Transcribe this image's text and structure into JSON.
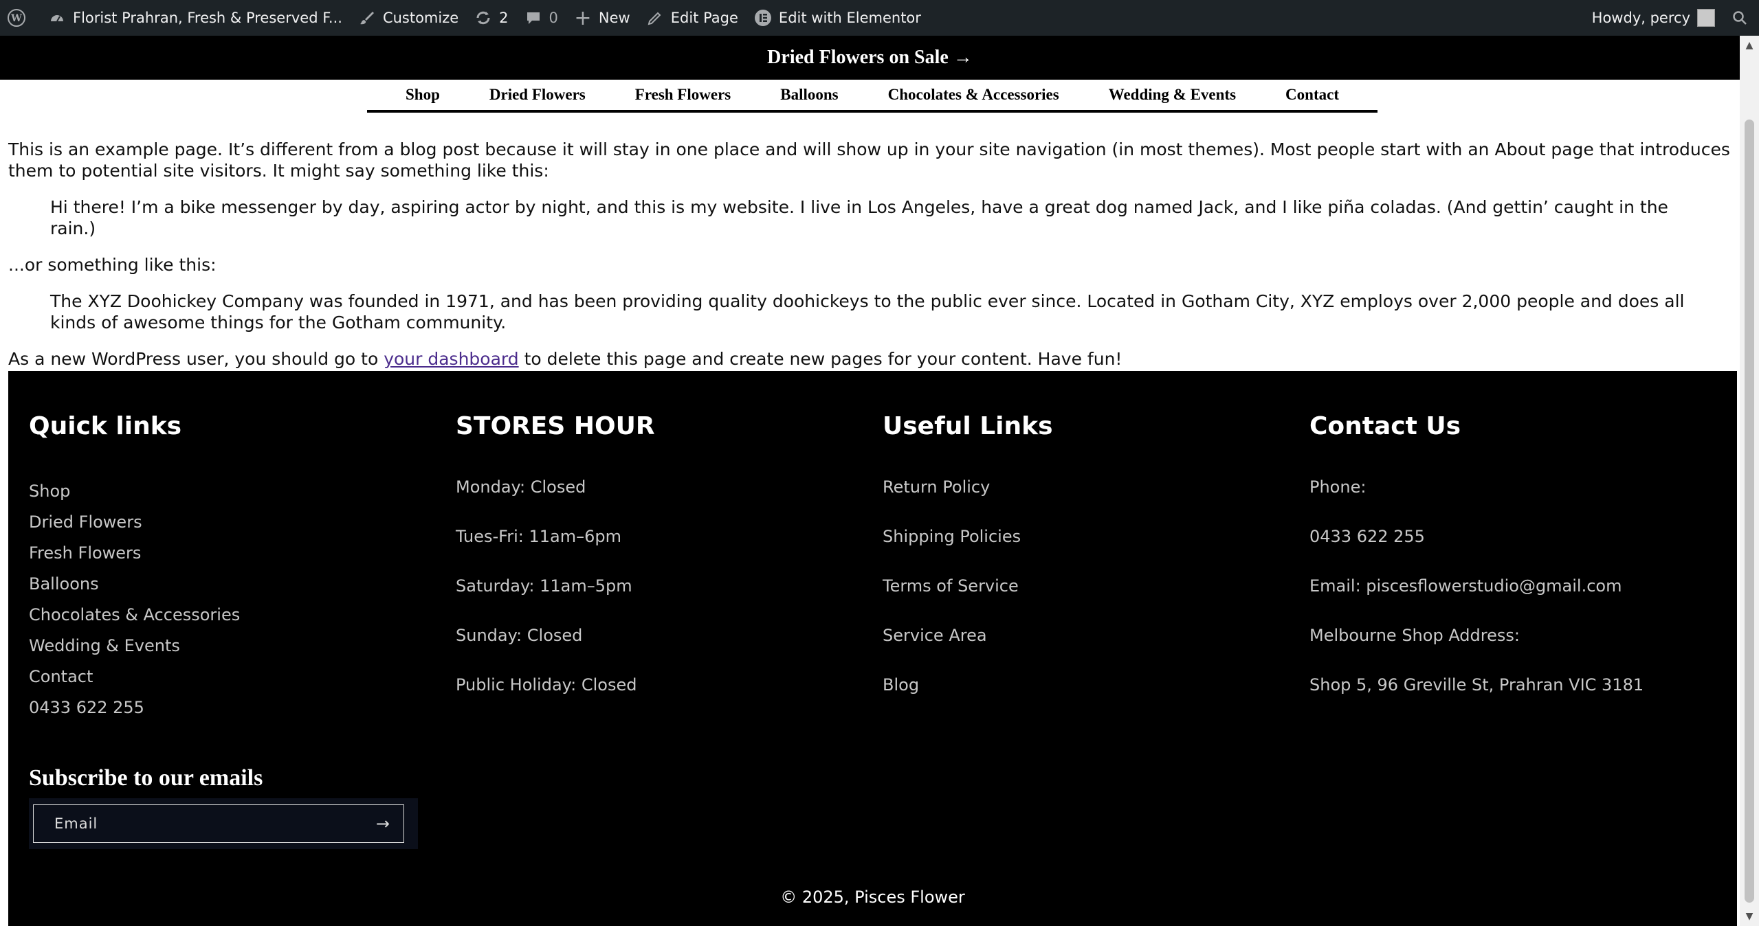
{
  "adminbar": {
    "site_name": "Florist Prahran, Fresh & Preserved F...",
    "customize": "Customize",
    "updates_count": "2",
    "comments_count": "0",
    "new": "New",
    "edit_page": "Edit Page",
    "edit_elementor": "Edit with Elementor",
    "howdy": "Howdy, percy"
  },
  "announcement": "Dried Flowers on Sale →",
  "nav": [
    "Shop",
    "Dried Flowers",
    "Fresh Flowers",
    "Balloons",
    "Chocolates & Accessories",
    "Wedding & Events",
    "Contact"
  ],
  "content": {
    "p1": "This is an example page. It’s different from a blog post because it will stay in one place and will show up in your site navigation (in most themes). Most people start with an About page that introduces them to potential site visitors. It might say something like this:",
    "quote1": "Hi there! I’m a bike messenger by day, aspiring actor by night, and this is my website. I live in Los Angeles, have a great dog named Jack, and I like piña coladas. (And gettin’ caught in the rain.)",
    "p2": "...or something like this:",
    "quote2": "The XYZ Doohickey Company was founded in 1971, and has been providing quality doohickeys to the public ever since. Located in Gotham City, XYZ employs over 2,000 people and does all kinds of awesome things for the Gotham community.",
    "p3_before": "As a new WordPress user, you should go to ",
    "p3_link": "your dashboard",
    "p3_after": " to delete this page and create new pages for your content. Have fun!"
  },
  "footer": {
    "quick_links": {
      "title": "Quick links",
      "items": [
        "Shop",
        "Dried Flowers",
        "Fresh Flowers",
        "Balloons",
        "Chocolates & Accessories",
        "Wedding & Events",
        "Contact",
        "0433 622 255"
      ]
    },
    "stores_hour": {
      "title": "STORES HOUR",
      "items": [
        "Monday: Closed",
        "Tues-Fri: 11am–6pm",
        "Saturday: 11am–5pm",
        "Sunday: Closed",
        "Public Holiday: Closed"
      ]
    },
    "useful_links": {
      "title": "Useful Links",
      "items": [
        "Return Policy",
        "Shipping Policies",
        "Terms of Service",
        "Service Area",
        "Blog"
      ]
    },
    "contact_us": {
      "title": "Contact Us",
      "items": [
        "Phone:",
        "0433 622 255",
        "Email: piscesflowerstudio@gmail.com",
        "Melbourne Shop Address:",
        "Shop 5, 96 Greville St, Prahran VIC 3181"
      ]
    },
    "subscribe": {
      "title": "Subscribe to our emails",
      "placeholder": "Email"
    },
    "copyright": "© 2025, Pisces Flower"
  }
}
